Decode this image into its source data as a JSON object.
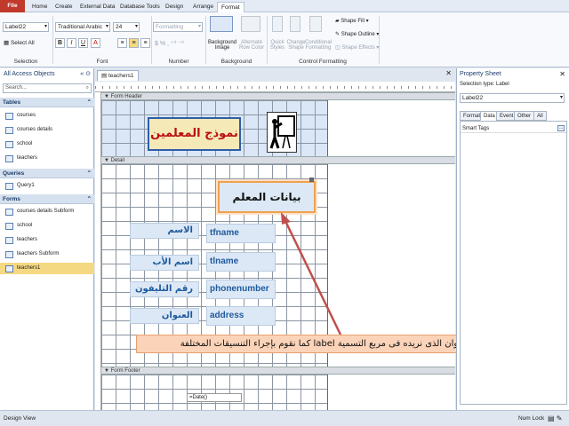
{
  "ribbon_tabs": [
    {
      "label": "File"
    },
    {
      "label": "Home"
    },
    {
      "label": "Create"
    },
    {
      "label": "External Data"
    },
    {
      "label": "Database Tools"
    },
    {
      "label": "Design"
    },
    {
      "label": "Arrange"
    },
    {
      "label": "Format"
    }
  ],
  "selection": {
    "combo": "Label22",
    "select_all": "Select All",
    "group": "Selection"
  },
  "font": {
    "family": "Traditional Arabic",
    "size": "24",
    "group": "Font"
  },
  "number": {
    "format": "Formatting",
    "group": "Number"
  },
  "background": {
    "bg_image": "Background Image",
    "alt_row": "Alternate Row Color",
    "group": "Background"
  },
  "control_fmt": {
    "quick": "Quick Styles",
    "change": "Change Shape",
    "cond": "Conditional Formatting",
    "fill": "Shape Fill",
    "outline": "Shape Outline",
    "effects": "Shape Effects",
    "group": "Control Formatting"
  },
  "nav": {
    "title": "All Access Objects",
    "search_placeholder": "Search...",
    "groups": [
      {
        "name": "Tables",
        "items": [
          "courses",
          "courses details",
          "school",
          "teachers"
        ]
      },
      {
        "name": "Queries",
        "items": [
          "Query1"
        ]
      },
      {
        "name": "Forms",
        "items": [
          "courses details Subform",
          "school",
          "teachers",
          "teachers Subform",
          "teachers1"
        ]
      }
    ]
  },
  "doc_tab": "teachers1",
  "sections": {
    "header": "Form Header",
    "detail": "Detail",
    "footer": "Form Footer"
  },
  "form": {
    "header_title": "نموذج المعلمين",
    "detail_title": "بيانات المعلم",
    "fields": [
      {
        "label": "الاسم",
        "box": "tfname"
      },
      {
        "label": "اسم الأب",
        "box": "tlname"
      },
      {
        "label": "رقم التليفون",
        "box": "phonenumber"
      },
      {
        "label": "العنوان",
        "box": "address"
      }
    ],
    "footer_box": "=Date()"
  },
  "annotation": "نقوم بكتابة العنوان الذى نريده فى مربع التسمية label كما نقوم بإجراء التنسيقات المختلفة",
  "props": {
    "title": "Property Sheet",
    "selection_type": "Selection type:  Label",
    "selected": "Label22",
    "tabs": [
      "Format",
      "Data",
      "Event",
      "Other",
      "All"
    ],
    "active_tab": "Data",
    "row": "Smart Tags"
  },
  "status": {
    "left": "Design View",
    "right": "Num Lock"
  },
  "colors": {
    "accent": "#c0392b",
    "annotation_bg": "#fbd3b8",
    "arrow": "#c0504d",
    "label_border": "#f0a050"
  }
}
